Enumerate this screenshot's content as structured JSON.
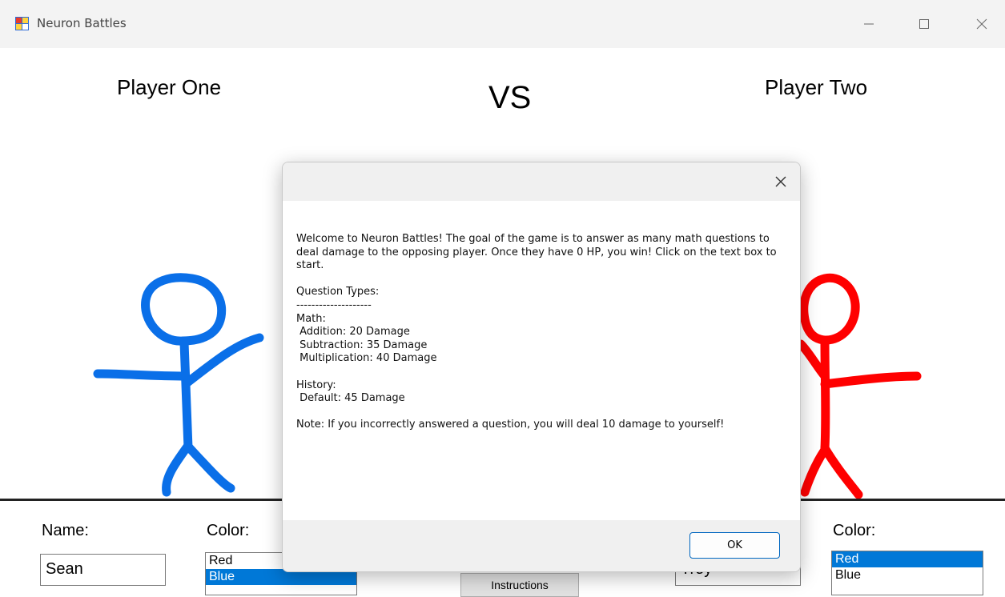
{
  "window": {
    "title": "Neuron Battles",
    "icon": "app-window-icon"
  },
  "arena": {
    "player_one_label": "Player One",
    "vs_label": "VS",
    "player_two_label": "Player Two"
  },
  "controls": {
    "p1_name_label": "Name:",
    "p1_name_value": "Sean",
    "p1_color_label": "Color:",
    "p1_color_options": [
      "Red",
      "Blue"
    ],
    "p1_color_selected": "Blue",
    "instructions_label": "Instructions",
    "p2_name_value": "Troy",
    "p2_color_label": "Color:",
    "p2_color_options": [
      "Red",
      "Blue"
    ],
    "p2_color_selected": "Red"
  },
  "dialog": {
    "intro": "Welcome to Neuron Battles! The goal of the game is to answer as many math questions to deal damage to the opposing player. Once they have 0 HP, you win! Click on the text box to start.",
    "types_heading": "Question Types:",
    "separator": "--------------------",
    "math_heading": "Math:",
    "addition": " Addition: 20 Damage",
    "subtraction": " Subtraction: 35 Damage",
    "multiplication": " Multiplication: 40 Damage",
    "history_heading": "History:",
    "default": " Default: 45 Damage",
    "note": "Note: If you incorrectly answered a question, you will deal 10 damage to yourself!",
    "ok_label": "OK"
  },
  "colors": {
    "player_one": "#0a6fe8",
    "player_two": "#ff0000",
    "selection": "#0078d7",
    "ok_border": "#0067c0"
  }
}
